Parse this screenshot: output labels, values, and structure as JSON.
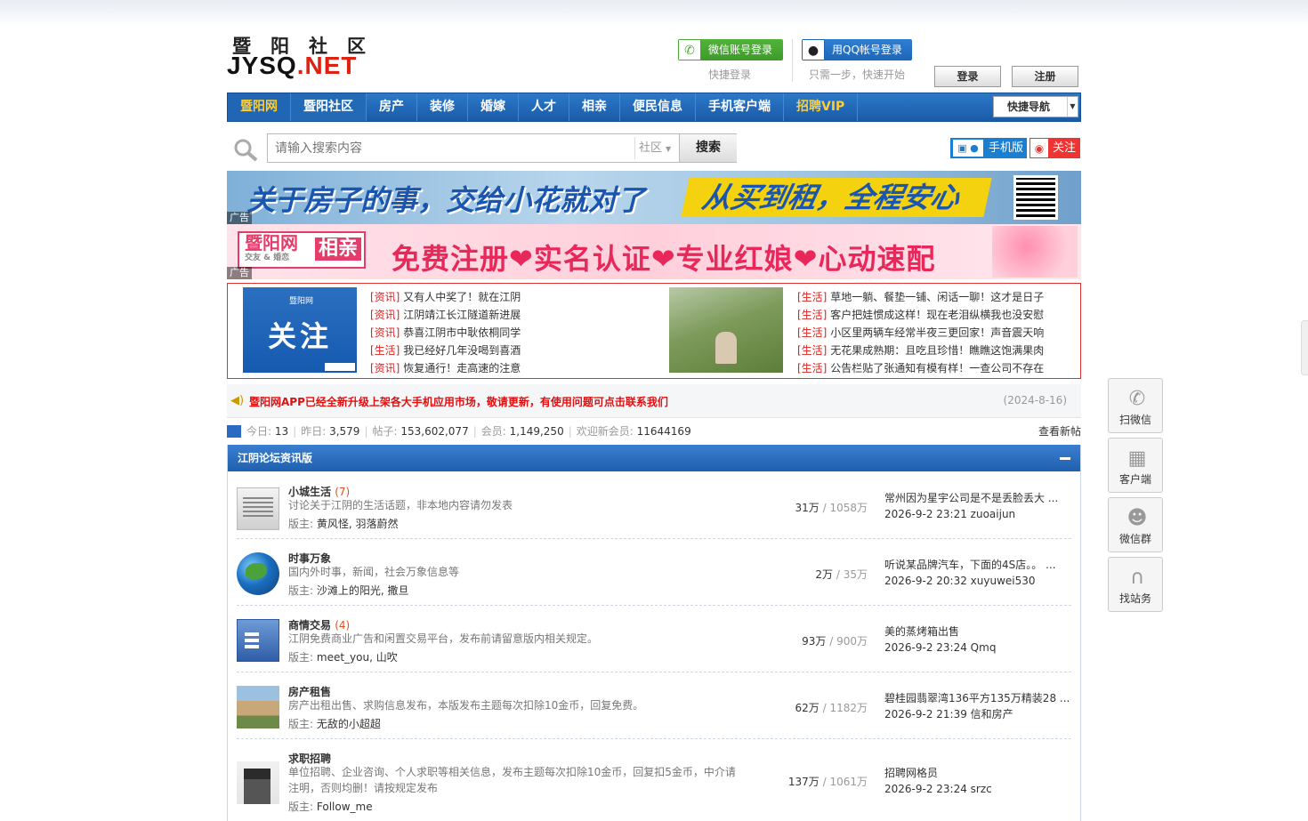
{
  "header": {
    "logo_cn": "暨阳社区",
    "logo_en_1": "JYSQ",
    "logo_en_2": ".NET",
    "wechat_login": "微信账号登录",
    "qq_login": "用QQ帐号登录",
    "quick_login": "快捷登录",
    "one_step": "只需一步，快速开始",
    "login_button": "登录",
    "register_button": "注册"
  },
  "nav": {
    "items": [
      "暨阳网",
      "暨阳社区",
      "房产",
      "装修",
      "婚嫁",
      "人才",
      "相亲",
      "便民信息",
      "手机客户端",
      "招聘VIP"
    ],
    "quick_nav": "快捷导航"
  },
  "search": {
    "placeholder": "请输入搜索内容",
    "scope": "社区",
    "button": "搜索",
    "mobile": "手机版",
    "follow": "关注"
  },
  "banners": {
    "banner1_text": "关于房子的事，交给小花就对了",
    "banner1_slogan": "从买到租，全程安心",
    "banner2_logo": "暨阳网",
    "banner2_logo_sub": "交友 & 婚恋",
    "banner2_logo_tag": "相亲",
    "banner2_text": "免费注册❤实名认证❤专业红娘❤心动速配",
    "ad_label": "广告"
  },
  "news": {
    "image1_small": "暨阳网",
    "image1_big": "关注",
    "left": [
      {
        "tag": "[资讯]",
        "title": "又有人中奖了！就在江阴"
      },
      {
        "tag": "[资讯]",
        "title": "江阴靖江长江隧道新进展"
      },
      {
        "tag": "[资讯]",
        "title": "恭喜江阴市中耿依桐同学"
      },
      {
        "tag": "[生活]",
        "title": "我已经好几年没喝到喜酒"
      },
      {
        "tag": "[资讯]",
        "title": "恢复通行！走高速的注意"
      }
    ],
    "right": [
      {
        "tag": "[生活]",
        "title": "草地一躺、餐垫一铺、闲话一聊！这才是日子"
      },
      {
        "tag": "[生活]",
        "title": "客户把娃惯成这样！现在老泪纵横我也没安慰"
      },
      {
        "tag": "[生活]",
        "title": "小区里两辆车经常半夜三更回家！声音震天响"
      },
      {
        "tag": "[生活]",
        "title": "无花果成熟期：且吃且珍惜！瞧瞧这饱满果肉"
      },
      {
        "tag": "[生活]",
        "title": "公告栏贴了张通知有模有样！一查公司不存在"
      }
    ]
  },
  "announcement": {
    "text": "暨阳网APP已经全新升级上架各大手机应用市场，敬请更新，有使用问题可点击联系我们",
    "date": "(2024-8-16)"
  },
  "stats": {
    "today_label": "今日:",
    "today": "13",
    "yesterday_label": "昨日:",
    "yesterday": "3,579",
    "posts_label": "帖子:",
    "posts": "153,602,077",
    "members_label": "会员:",
    "members": "1,149,250",
    "welcome_label": "欢迎新会员:",
    "welcome": "11644169",
    "new_posts": "查看新帖"
  },
  "forum": {
    "title": "江阴论坛资讯版",
    "boards": [
      {
        "name": "小城生活",
        "new": "(7)",
        "desc": "讨论关于江阴的生活话题，非本地内容请勿发表",
        "mods_label": "版主:",
        "mods": "黄风怪, 羽落蔚然",
        "threads": "31万",
        "posts": "/ 1058万",
        "last_title": "常州因为星宇公司是不是丢脸丢大 ...",
        "last_time": "2026-9-2 23:21 zuoaijun"
      },
      {
        "name": "时事万象",
        "new": "",
        "desc": "国内外时事，新闻，社会万象信息等",
        "mods_label": "版主:",
        "mods": "沙滩上的阳光, 撒旦",
        "threads": "2万",
        "posts": "/ 35万",
        "last_title": "听说某品牌汽车，下面的4S店。。 ...",
        "last_time": "2026-9-2 20:32 xuyuwei530"
      },
      {
        "name": "商情交易",
        "new": "(4)",
        "desc": "江阴免费商业广告和闲置交易平台，发布前请留意版内相关规定。",
        "mods_label": "版主:",
        "mods": "meet_you, 山吹",
        "threads": "93万",
        "posts": "/ 900万",
        "last_title": "美的蒸烤箱出售",
        "last_time": "2026-9-2 23:24 Qmq"
      },
      {
        "name": "房产租售",
        "new": "",
        "desc": "房产出租出售、求购信息发布，本版发布主题每次扣除10金币，回复免费。",
        "mods_label": "版主:",
        "mods": "无敌的小超超",
        "threads": "62万",
        "posts": "/ 1182万",
        "last_title": "碧桂园翡翠湾136平方135万精装28 ...",
        "last_time": "2026-9-2 21:39 信和房产"
      },
      {
        "name": "求职招聘",
        "new": "",
        "desc": "单位招聘、企业咨询、个人求职等相关信息，发布主题每次扣除10金币，回复扣5金币，中介请注明，否则均删！请按规定发布",
        "mods_label": "版主:",
        "mods": "Follow_me",
        "threads": "137万",
        "posts": "/ 1061万",
        "last_title": "招聘网格员",
        "last_time": "2026-9-2 23:24 srzc"
      }
    ]
  },
  "float_bar": {
    "items": [
      {
        "icon": "wechat-icon",
        "label": "扫微信"
      },
      {
        "icon": "qrcode-icon",
        "label": "客户端"
      },
      {
        "icon": "group-icon",
        "label": "微信群"
      },
      {
        "icon": "headset-icon",
        "label": "找站务"
      }
    ]
  }
}
